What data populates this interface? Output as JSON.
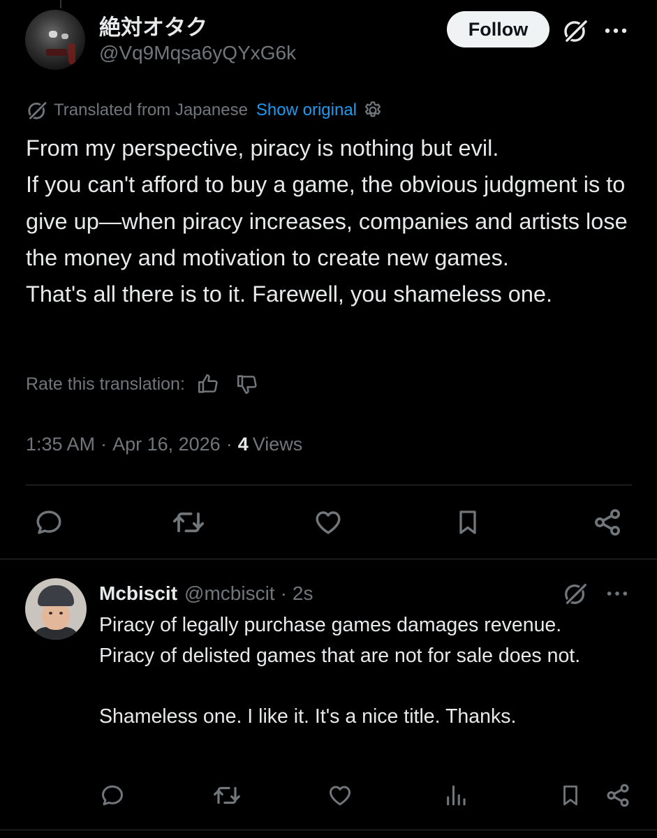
{
  "tweet": {
    "display_name": "絶対オタク",
    "handle": "@Vq9Mqsa6yQYxG6k",
    "follow_label": "Follow",
    "translated_label": "Translated from Japanese",
    "show_original_label": "Show original",
    "text": "From my perspective, piracy is nothing but evil.\nIf you can't afford to buy a game, the obvious judgment is to give up—when piracy increases, companies and artists lose the money and motivation to create new games.\nThat's all there is to it. Farewell, you shameless one.",
    "rate_label": "Rate this translation:",
    "time": "1:35 AM",
    "sep1": "·",
    "date": "Apr 16, 2026",
    "sep2": "·",
    "views_count": "4",
    "views_label": "Views"
  },
  "reply": {
    "display_name": "Mcbiscit",
    "handle": "@mcbiscit",
    "sep": "·",
    "time": "2s",
    "text": "Piracy of legally purchase games damages revenue.\nPiracy of delisted games that are not for sale does not.\n\nShameless one. I like it. It's a nice title. Thanks."
  },
  "icons": {
    "grok": "grok-icon",
    "more": "more-icon",
    "gear": "gear-icon",
    "reply": "reply-icon",
    "retweet": "retweet-icon",
    "like": "like-icon",
    "bookmark": "bookmark-icon",
    "share": "share-icon",
    "views": "views-icon",
    "thumbs_up": "thumbs-up-icon",
    "thumbs_down": "thumbs-down-icon"
  },
  "colors": {
    "background": "#000000",
    "text": "#e7e9ea",
    "secondary": "#71767b",
    "link": "#1d9bf0",
    "divider": "#2f3336",
    "follow_bg": "#eff3f4"
  }
}
